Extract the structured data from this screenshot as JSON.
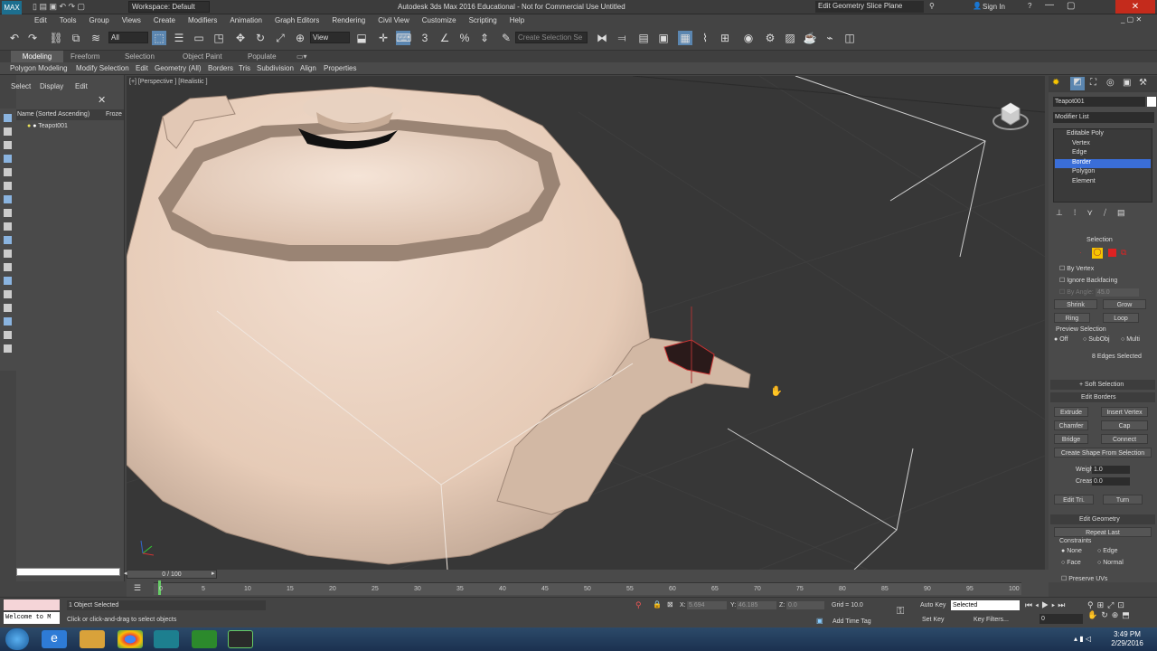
{
  "title": {
    "workspace": "Workspace: Default",
    "app": "Autodesk 3ds Max 2016 Educational - Not for Commercial Use  Untitled",
    "search": "Edit Geometry Slice Plane",
    "signin": "Sign In"
  },
  "menu": [
    "Edit",
    "Tools",
    "Group",
    "Views",
    "Create",
    "Modifiers",
    "Animation",
    "Graph Editors",
    "Rendering",
    "Civil View",
    "Customize",
    "Scripting",
    "Help"
  ],
  "toolbar": {
    "filter": "All",
    "refcoord": "View",
    "selset": "Create Selection Se"
  },
  "ribbon": {
    "tabs": [
      "Modeling",
      "Freeform",
      "Selection",
      "Object Paint",
      "Populate"
    ],
    "buttons": [
      "Polygon Modeling",
      "Modify Selection",
      "Edit",
      "Geometry (All)",
      "Borders",
      "Tris",
      "Subdivision",
      "Align",
      "Properties"
    ]
  },
  "scene": {
    "menu": [
      "Select",
      "Display",
      "Edit"
    ],
    "col": "Name (Sorted Ascending)",
    "col2": "Froze",
    "object": "Teapot001",
    "workspace": "Workspace: Default"
  },
  "viewport": {
    "label": "[+] [Perspective ] [Realistic ]"
  },
  "cmd": {
    "name": "Teapot001",
    "modlist": "Modifier List",
    "stack": [
      "Editable Poly",
      "Vertex",
      "Edge",
      "Border",
      "Polygon",
      "Element"
    ],
    "selected": "Border",
    "selection": {
      "title": "Selection",
      "by_vertex": "By Vertex",
      "ignore": "Ignore Backfacing",
      "by_angle": "By Angle:",
      "angle": "45.0",
      "shrink": "Shrink",
      "grow": "Grow",
      "ring": "Ring",
      "loop": "Loop",
      "preview": "Preview Selection",
      "off": "Off",
      "subobj": "SubObj",
      "multi": "Multi",
      "status": "8 Edges Selected"
    },
    "soft": "Soft Selection",
    "borders": {
      "title": "Edit Borders",
      "extrude": "Extrude",
      "insert": "Insert Vertex",
      "chamfer": "Chamfer",
      "cap": "Cap",
      "bridge": "Bridge",
      "connect": "Connect",
      "shape": "Create Shape From Selection",
      "weight_lbl": "Weight:",
      "weight": "1.0",
      "crease_lbl": "Crease:",
      "crease": "0.0",
      "edittri": "Edit Tri.",
      "turn": "Turn"
    },
    "geom": {
      "title": "Edit Geometry",
      "repeat": "Repeat Last",
      "constraints": "Constraints",
      "none": "None",
      "edge": "Edge",
      "face": "Face",
      "normal": "Normal",
      "preserve": "Preserve UVs"
    }
  },
  "timeline": {
    "frame": "0 / 100",
    "ticks": [
      "0",
      "5",
      "10",
      "15",
      "20",
      "25",
      "30",
      "35",
      "40",
      "45",
      "50",
      "55",
      "60",
      "65",
      "70",
      "75",
      "80",
      "85",
      "90",
      "95",
      "100"
    ]
  },
  "status": {
    "welcome": "Welcome to M",
    "selected": "1 Object Selected",
    "hint": "Click or click-and-drag to select objects",
    "x_lbl": "X:",
    "x": "5.694",
    "y_lbl": "Y:",
    "y": "46.185",
    "z_lbl": "Z:",
    "z": "0.0",
    "grid": "Grid = 10.0",
    "addtag": "Add Time Tag",
    "autokey": "Auto Key",
    "setkey": "Set Key",
    "keymode": "Selected",
    "keyfilters": "Key Filters...",
    "frame": "0"
  },
  "clock": {
    "time": "3:49 PM",
    "date": "2/29/2016"
  }
}
